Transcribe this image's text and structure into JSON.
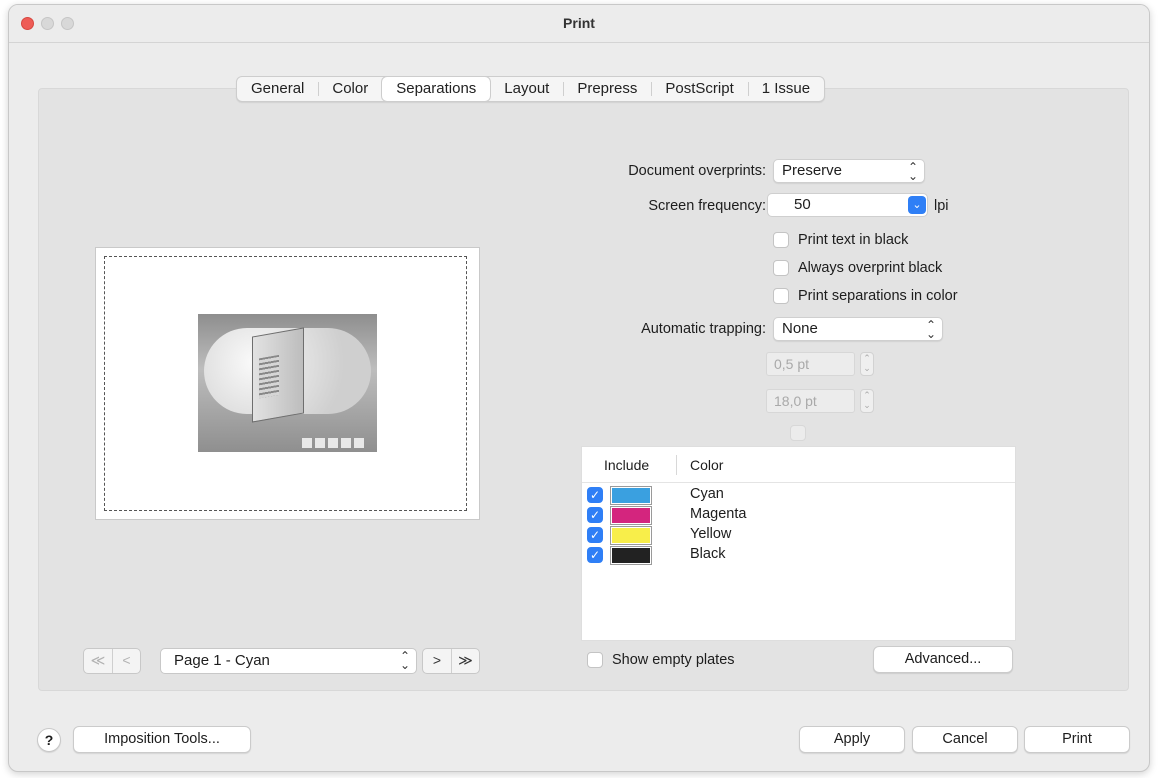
{
  "window": {
    "title": "Print"
  },
  "tabs": [
    {
      "label": "General",
      "active": false
    },
    {
      "label": "Color",
      "active": false
    },
    {
      "label": "Separations",
      "active": true
    },
    {
      "label": "Layout",
      "active": false
    },
    {
      "label": "Prepress",
      "active": false
    },
    {
      "label": "PostScript",
      "active": false
    },
    {
      "label": "1 Issue",
      "active": false
    }
  ],
  "preview": {
    "page_selector": "Page 1 - Cyan",
    "nav": {
      "first": "≪",
      "prev": "<",
      "next": ">",
      "last": "≫"
    }
  },
  "settings": {
    "document_overprints": {
      "label": "Document overprints:",
      "value": "Preserve"
    },
    "screen_frequency": {
      "label": "Screen frequency:",
      "value": "50",
      "unit": "lpi"
    },
    "print_text_in_black": {
      "label": "Print text in black",
      "checked": false
    },
    "always_overprint_black": {
      "label": "Always overprint black",
      "checked": false
    },
    "print_separations_in_color": {
      "label": "Print separations in color",
      "checked": false
    },
    "automatic_trapping": {
      "label": "Automatic trapping:",
      "value": "None"
    },
    "trap_width": "0,5 pt",
    "trap_threshold": "18,0 pt"
  },
  "plates": {
    "headers": {
      "include": "Include",
      "color": "Color"
    },
    "rows": [
      {
        "name": "Cyan",
        "color": "#3aa0e0",
        "included": true
      },
      {
        "name": "Magenta",
        "color": "#d4257e",
        "included": true
      },
      {
        "name": "Yellow",
        "color": "#f8ee4a",
        "included": true
      },
      {
        "name": "Black",
        "color": "#222222",
        "included": true
      }
    ],
    "show_empty_plates": {
      "label": "Show empty plates",
      "checked": false
    },
    "advanced_button": "Advanced..."
  },
  "footer": {
    "help": "?",
    "imposition_tools": "Imposition Tools...",
    "apply": "Apply",
    "cancel": "Cancel",
    "print": "Print"
  },
  "icons": {
    "checkmark": "✓",
    "updown": "⌃⌄",
    "chevron_down": "⌄"
  }
}
